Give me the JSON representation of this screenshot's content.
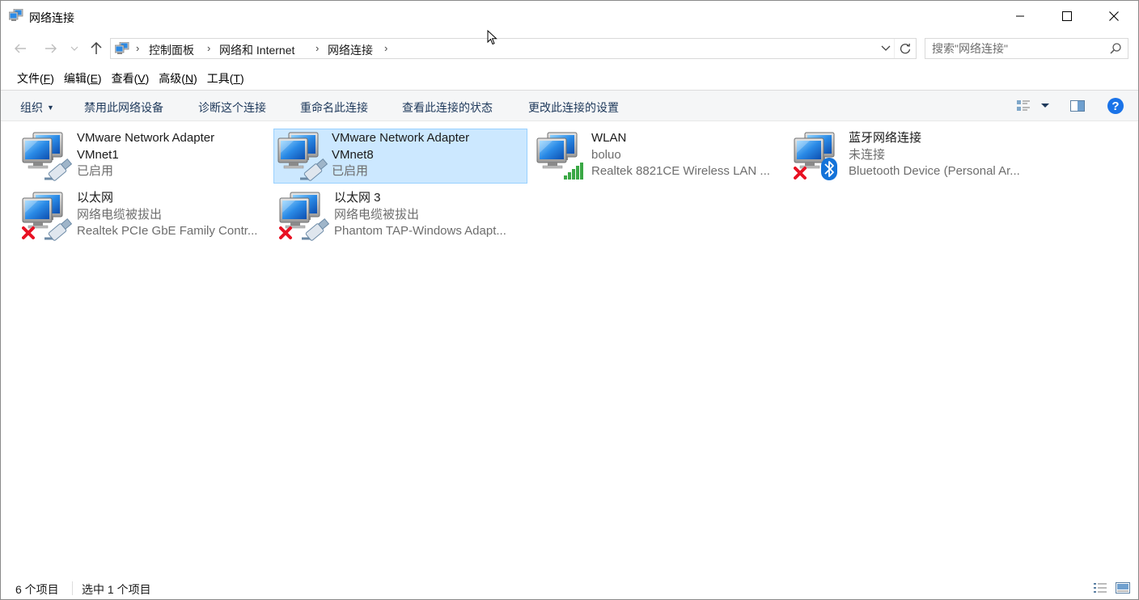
{
  "window": {
    "title": "网络连接"
  },
  "breadcrumb": [
    "控制面板",
    "网络和 Internet",
    "网络连接"
  ],
  "search": {
    "placeholder": "搜索\"网络连接\""
  },
  "menu": [
    {
      "label": "文件(",
      "key": "F",
      "tail": ")"
    },
    {
      "label": "编辑(",
      "key": "E",
      "tail": ")"
    },
    {
      "label": "查看(",
      "key": "V",
      "tail": ")"
    },
    {
      "label": "高级(",
      "key": "N",
      "tail": ")"
    },
    {
      "label": "工具(",
      "key": "T",
      "tail": ")"
    }
  ],
  "commands": {
    "organize": "组织",
    "disable": "禁用此网络设备",
    "diagnose": "诊断这个连接",
    "rename": "重命名此连接",
    "status": "查看此连接的状态",
    "settings": "更改此连接的设置"
  },
  "connections": [
    {
      "name": "VMware Network Adapter VMnet1",
      "name1": "VMware Network Adapter",
      "name2": "VMnet1",
      "status": "已启用",
      "device": "",
      "icon": "network-adapter-icon",
      "selected": false
    },
    {
      "name": "VMware Network Adapter VMnet8",
      "name1": "VMware Network Adapter",
      "name2": "VMnet8",
      "status": "已启用",
      "device": "",
      "icon": "network-adapter-icon",
      "selected": true
    },
    {
      "name": "WLAN",
      "status": "boluo",
      "device": "Realtek 8821CE Wireless LAN ...",
      "icon": "wifi-signal-icon",
      "selected": false
    },
    {
      "name": "蓝牙网络连接",
      "status": "未连接",
      "device": "Bluetooth Device (Personal Ar...",
      "icon": "bluetooth-icon",
      "selected": false
    },
    {
      "name": "以太网",
      "status": "网络电缆被拔出",
      "device": "Realtek PCIe GbE Family Contr...",
      "icon": "disconnected-x-icon",
      "selected": false
    },
    {
      "name": "以太网 3",
      "status": "网络电缆被拔出",
      "device": "Phantom TAP-Windows Adapt...",
      "icon": "disconnected-x-icon",
      "selected": false
    }
  ],
  "statusbar": {
    "count": "6 个项目",
    "selected": "选中 1 个项目"
  },
  "colors": {
    "selection_bg": "#cce8ff",
    "selection_border": "#99d1ff",
    "command_text": "#1e395b",
    "help_blue": "#1a73e8"
  }
}
